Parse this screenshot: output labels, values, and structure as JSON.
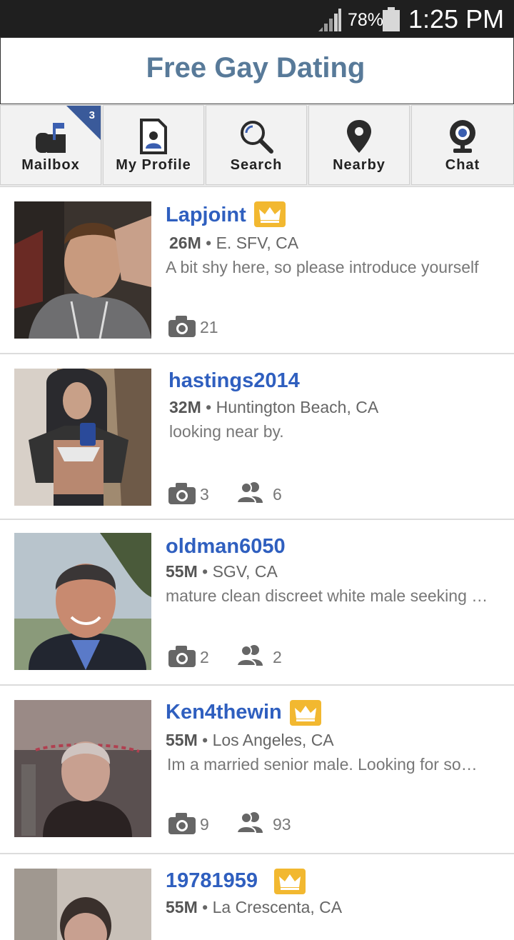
{
  "status_bar": {
    "battery_percent": "78%",
    "time": "1:25 PM"
  },
  "header": {
    "title": "Free Gay Dating"
  },
  "nav": {
    "tabs": [
      {
        "label": "Mailbox",
        "icon": "mailbox-icon",
        "badge": "3"
      },
      {
        "label": "My Profile",
        "icon": "profile-icon"
      },
      {
        "label": "Search",
        "icon": "search-icon"
      },
      {
        "label": "Nearby",
        "icon": "location-pin-icon"
      },
      {
        "label": "Chat",
        "icon": "webcam-icon"
      }
    ]
  },
  "colors": {
    "title": "#587a99",
    "username": "#2f5fbf",
    "badge": "#3a5a9a",
    "crown": "#f2b830"
  },
  "profiles": [
    {
      "username": "Lapjoint",
      "premium": true,
      "age_sex": "26M",
      "location": "E. SFV, CA",
      "bio": "A bit shy here, so please introduce yourself",
      "photos": "21",
      "friends": ""
    },
    {
      "username": "hastings2014",
      "premium": false,
      "age_sex": "32M",
      "location": "Huntington Beach, CA",
      "bio": "looking near by.",
      "photos": "3",
      "friends": "6"
    },
    {
      "username": "oldman6050",
      "premium": false,
      "age_sex": "55M",
      "location": "SGV, CA",
      "bio": "mature clean discreet white male seeking …",
      "photos": "2",
      "friends": "2"
    },
    {
      "username": "Ken4thewin",
      "premium": true,
      "age_sex": "55M",
      "location": "Los Angeles, CA",
      "bio": "Im a married senior male. Looking for so…",
      "photos": "9",
      "friends": "93"
    },
    {
      "username": "19781959",
      "premium": true,
      "age_sex": "55M",
      "location": "La Crescenta, CA",
      "bio": "",
      "photos": "",
      "friends": ""
    }
  ]
}
